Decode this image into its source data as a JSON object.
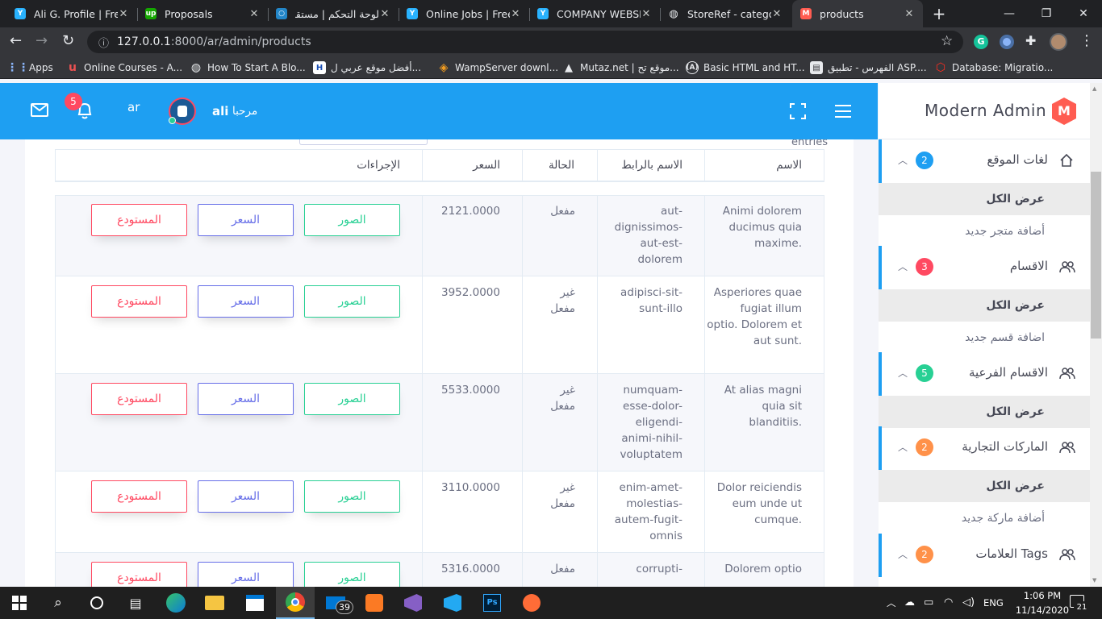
{
  "browser": {
    "tabs": [
      {
        "title": "Ali G. Profile | Free",
        "icon": "freelancer-icon",
        "color": "#29b2fe"
      },
      {
        "title": "Proposals",
        "icon": "upwork-icon",
        "color": "#14a800"
      },
      {
        "title": "لوحة التحكم | مستقل",
        "icon": "mostaql-icon",
        "color": "#2386c8"
      },
      {
        "title": "Online Jobs | Freel",
        "icon": "freelancer-icon",
        "color": "#29b2fe"
      },
      {
        "title": "COMPANY WEBSI",
        "icon": "freelancer-icon",
        "color": "#29b2fe"
      },
      {
        "title": "StoreRef - categor",
        "icon": "globe-icon",
        "color": "#e8eaed"
      },
      {
        "title": "products",
        "icon": "modern-admin-icon",
        "color": "#ff5c51"
      }
    ],
    "url_host": "127.0.0.1",
    "url_path": ":8000/ar/admin/products",
    "bookmarks": [
      {
        "label": "Apps"
      },
      {
        "label": "Online Courses - A..."
      },
      {
        "label": "How To Start A Blo..."
      },
      {
        "label": "أفضل موقع عربي ل..."
      },
      {
        "label": "WampServer downl..."
      },
      {
        "label": "Mutaz.net | موقع تح..."
      },
      {
        "label": "Basic HTML and HT..."
      },
      {
        "label": "الفهرس - تطبيق ASP...."
      },
      {
        "label": "Database: Migratio..."
      }
    ]
  },
  "header": {
    "notification_count": "5",
    "lang": "ar",
    "greeting": "مرحبا",
    "username": "ali",
    "brand": "Modern Admin",
    "brand_logo": "M"
  },
  "table": {
    "entries_label": "entries",
    "headers": {
      "name": "الاسم",
      "slug": "الاسم بالرابط",
      "status": "الحالة",
      "price": "السعر",
      "actions": "الإجراءات"
    },
    "buttons": {
      "images": "الصور",
      "price": "السعر",
      "stock": "المستودع"
    },
    "rows": [
      {
        "name": "Animi dolorem ducimus quia maxime.",
        "slug": "aut-dignissimos-aut-est-dolorem",
        "status": "مفعل",
        "price": "2121.0000"
      },
      {
        "name": "Asperiores quae fugiat illum optio. Dolorem et aut sunt.",
        "slug": "adipisci-sit-sunt-illo",
        "status": "غير مفعل",
        "price": "3952.0000"
      },
      {
        "name": "At alias magni quia sit blanditiis.",
        "slug": "numquam-esse-dolor-eligendi-animi-nihil-voluptatem",
        "status": "غير مفعل",
        "price": "5533.0000"
      },
      {
        "name": "Dolor reiciendis eum unde ut cumque.",
        "slug": "enim-amet-molestias-autem-fugit-omnis",
        "status": "غير مفعل",
        "price": "3110.0000"
      },
      {
        "name": "Dolorem optio",
        "slug": "corrupti-",
        "status": "مفعل",
        "price": "5316.0000"
      }
    ]
  },
  "sidebar": {
    "groups": [
      {
        "label": "لغات الموقع",
        "count": "2",
        "badge_color": "#1e9ff2",
        "icon": "home-icon"
      },
      {
        "label": "الاقسام",
        "count": "3",
        "badge_color": "#ff4961",
        "icon": "users-icon"
      },
      {
        "label": "الاقسام الفرعية",
        "count": "5",
        "badge_color": "#28d094",
        "icon": "users-icon"
      },
      {
        "label": "الماركات التجارية",
        "count": "2",
        "badge_color": "#ff9149",
        "icon": "users-icon"
      },
      {
        "label": "العلامات Tags",
        "count": "2",
        "badge_color": "#ff9149",
        "icon": "users-icon"
      }
    ],
    "subs": {
      "view_all": "عرض الكل",
      "add_store": "أضافة متجر جديد",
      "add_section": "اضافة قسم جديد",
      "add_brand": "أضافة ماركة جديد"
    }
  },
  "taskbar": {
    "lang": "ENG",
    "time": "1:06 PM",
    "date": "11/14/2020",
    "mail_count": "39",
    "notif_count": "21"
  }
}
